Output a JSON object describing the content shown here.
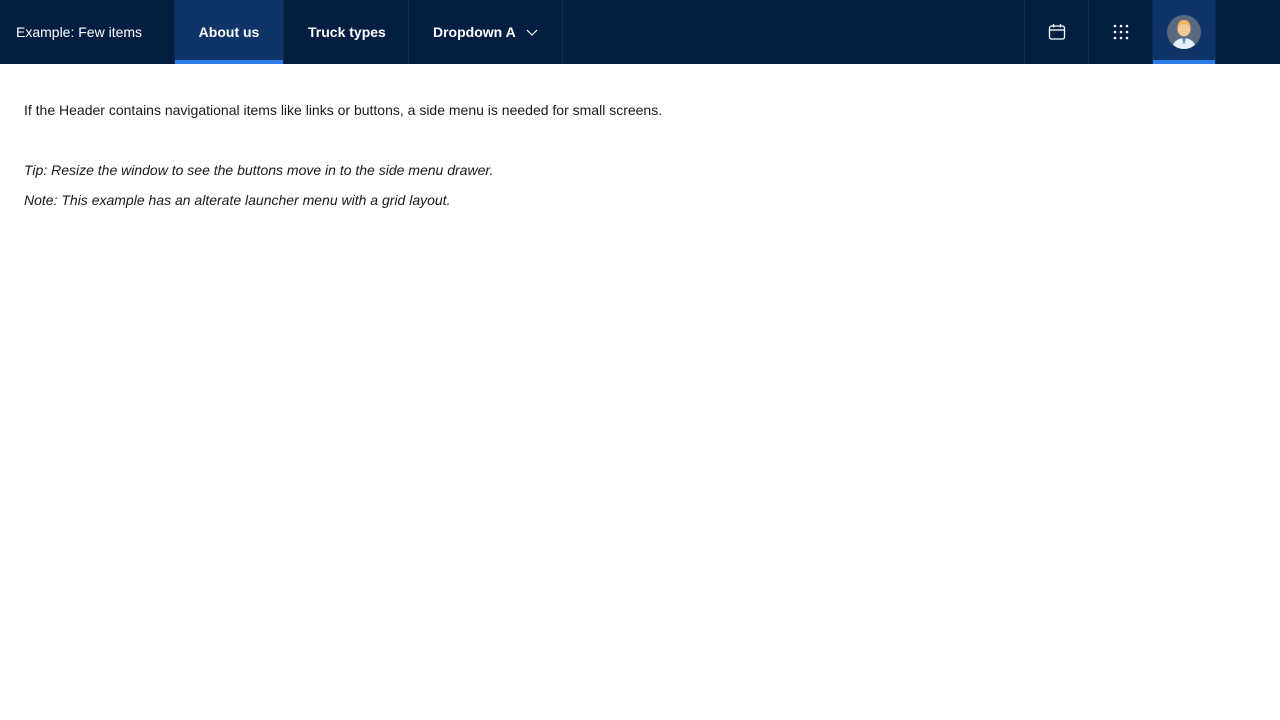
{
  "header": {
    "brand": "Example: Few items",
    "nav": [
      {
        "label": "About us",
        "active": true
      },
      {
        "label": "Truck types",
        "active": false
      },
      {
        "label": "Dropdown A",
        "active": false
      }
    ],
    "actions": {
      "calendar_icon": "calendar-icon",
      "apps_icon": "app-launcher-grid-icon",
      "avatar_icon": "user-avatar"
    }
  },
  "content": {
    "paragraph": "If the Header contains navigational items like links or buttons, a side menu is needed for small screens.",
    "tip": "Tip: Resize the window to see the buttons move in to the side menu drawer.",
    "note": "Note: This example has an alterate launcher menu with a grid layout."
  },
  "colors": {
    "header_bg": "#041e42",
    "active_bg": "#0f3468",
    "accent": "#2d7be5"
  }
}
